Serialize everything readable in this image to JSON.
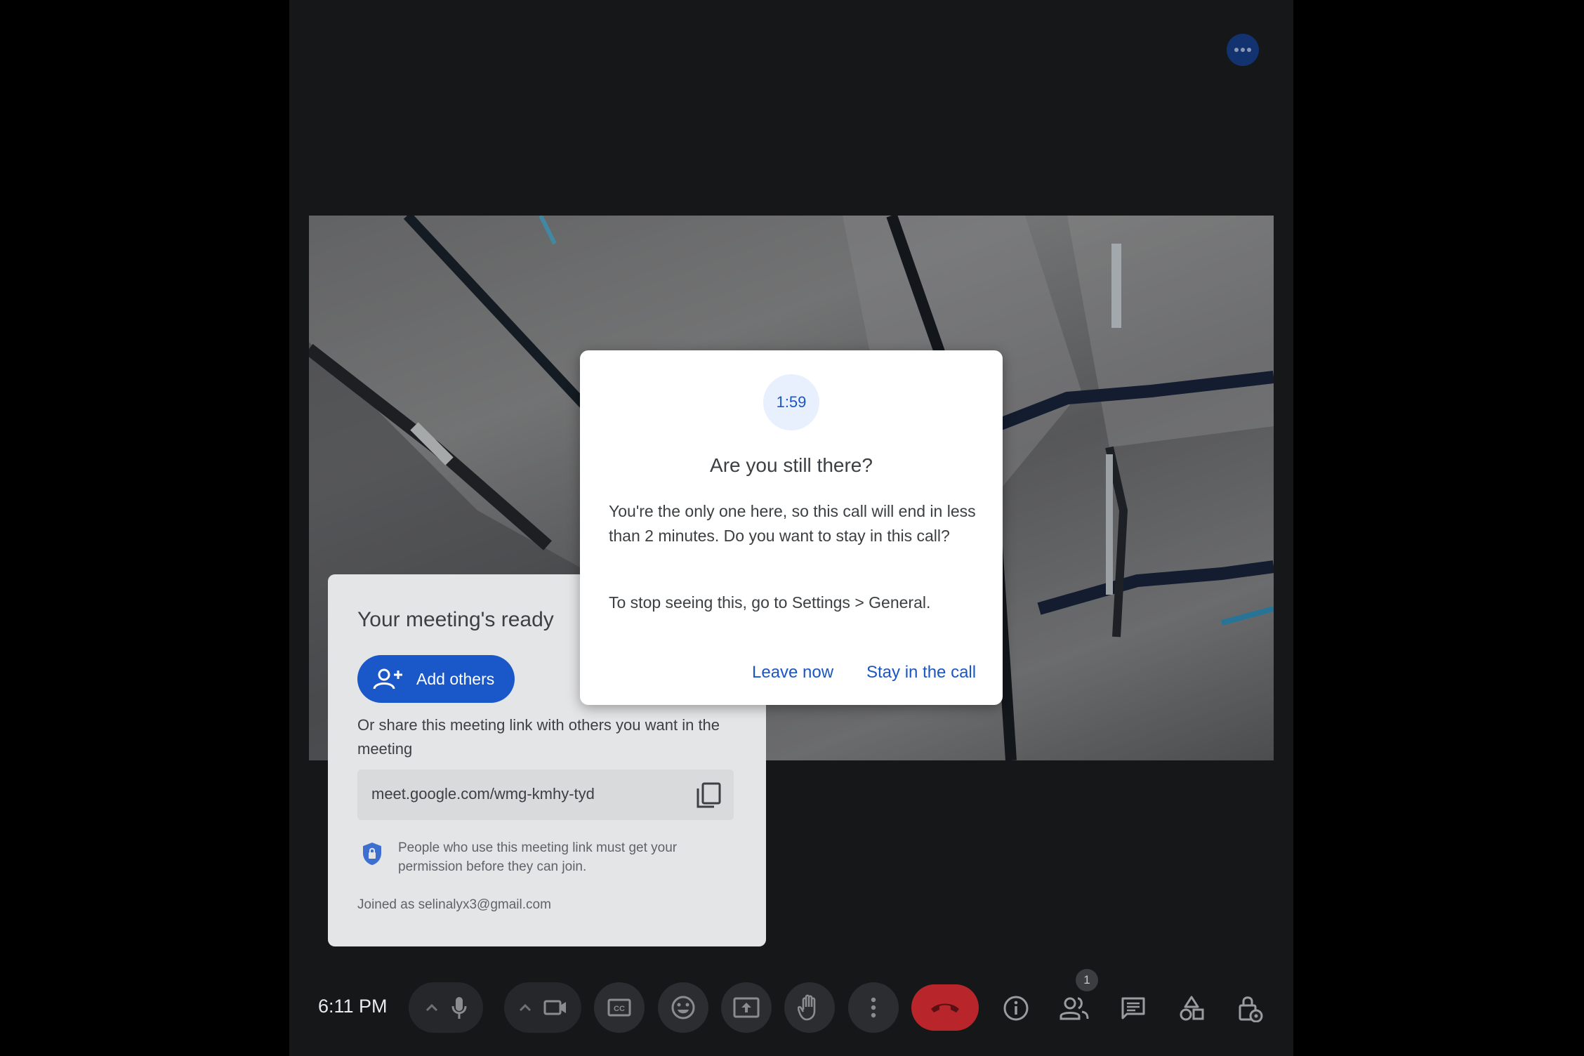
{
  "meeting_ready": {
    "title": "Your meeting's ready",
    "add_others_label": "Add others",
    "share_text": "Or share this meeting link with others you want in the meeting",
    "link": "meet.google.com/wmg-kmhy-tyd",
    "permission_text": "People who use this meeting link must get your permission before they can join.",
    "joined_as": "Joined as selinalyx3@gmail.com"
  },
  "dialog": {
    "countdown": "1:59",
    "title": "Are you still there?",
    "body": "You're the only one here, so this call will end in less than 2 minutes. Do you want to stay in this call?",
    "hint": "To stop seeing this, go to Settings > General.",
    "leave_label": "Leave now",
    "stay_label": "Stay in the call"
  },
  "toolbar": {
    "time": "6:11 PM",
    "participants_count": "1"
  },
  "icons": {
    "top_more": "more-horiz-icon",
    "mic": "microphone-icon",
    "camera": "video-camera-icon",
    "captions": "closed-captions-icon",
    "emoji": "emoji-reaction-icon",
    "present": "present-screen-icon",
    "hand": "raise-hand-icon",
    "more": "more-vert-icon",
    "end_call": "end-call-icon",
    "info": "info-icon",
    "people": "people-icon",
    "chat": "chat-icon",
    "activities": "activities-icon",
    "host_controls": "host-controls-lock-icon"
  },
  "colors": {
    "accent_blue": "#1a56c4",
    "end_call_red": "#b8262b",
    "stage_bg": "#202124"
  }
}
